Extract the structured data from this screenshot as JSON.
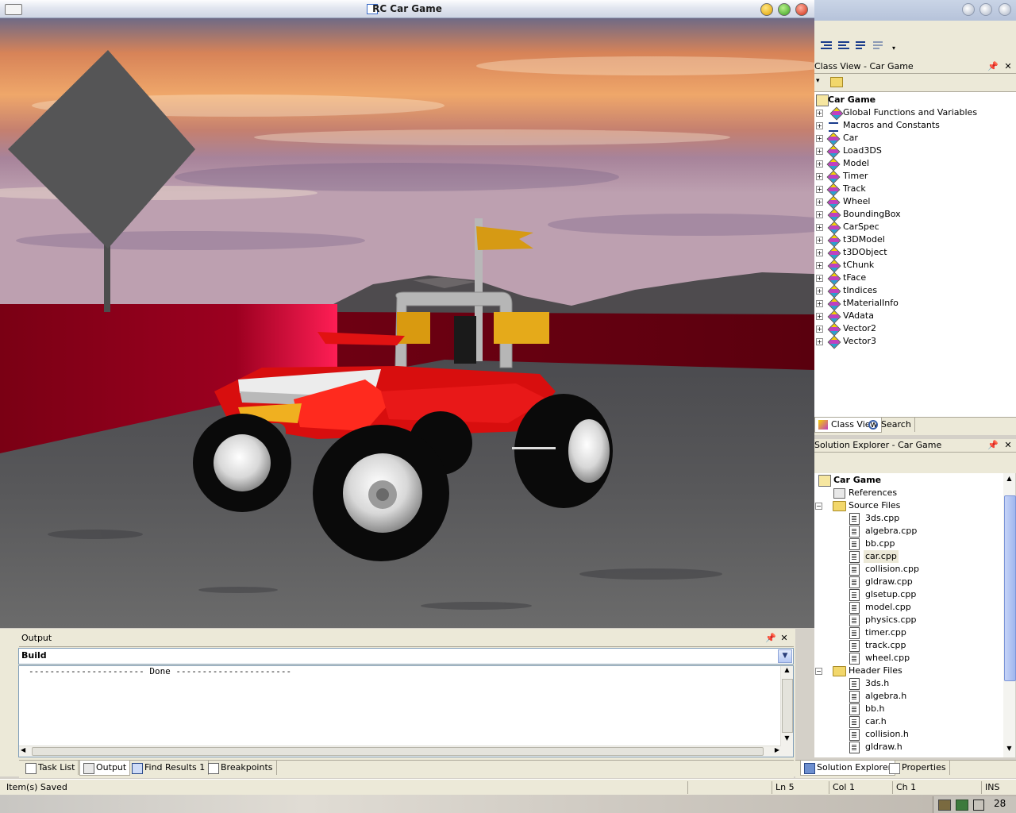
{
  "game_window": {
    "title": "RC Car Game"
  },
  "class_view": {
    "title": "Class View - Car Game",
    "root": "Car Game",
    "items": [
      "Global Functions and Variables",
      "Macros and Constants",
      "Car",
      "Load3DS",
      "Model",
      "Timer",
      "Track",
      "Wheel",
      "BoundingBox",
      "CarSpec",
      "t3DModel",
      "t3DObject",
      "tChunk",
      "tFace",
      "tIndices",
      "tMaterialInfo",
      "VAdata",
      "Vector2",
      "Vector3"
    ],
    "tabs": [
      "Class View",
      "Search"
    ]
  },
  "solution_explorer": {
    "title": "Solution Explorer - Car Game",
    "root": "Car Game",
    "references": "References",
    "source_folder": "Source Files",
    "source_files": [
      "3ds.cpp",
      "algebra.cpp",
      "bb.cpp",
      "car.cpp",
      "collision.cpp",
      "gldraw.cpp",
      "glsetup.cpp",
      "model.cpp",
      "physics.cpp",
      "timer.cpp",
      "track.cpp",
      "wheel.cpp"
    ],
    "header_folder": "Header Files",
    "header_files": [
      "3ds.h",
      "algebra.h",
      "bb.h",
      "car.h",
      "collision.h",
      "gldraw.h"
    ],
    "selected_file": "car.cpp",
    "tabs": [
      "Solution Explorer",
      "Properties"
    ]
  },
  "output": {
    "title": "Output",
    "source": "Build",
    "text": "---------------------- Done ----------------------",
    "tabs": [
      "Task List",
      "Output",
      "Find Results 1",
      "Breakpoints"
    ],
    "active_tab": "Output"
  },
  "status": {
    "message": "Item(s) Saved",
    "ln": "Ln 5",
    "col": "Col 1",
    "ch": "Ch 1",
    "mode": "INS"
  },
  "tray": {
    "clock": "28"
  },
  "colors": {
    "selection": "#316ac5",
    "wall": "#6e0010",
    "car_body": "#e01010",
    "accent": "#e8b020"
  }
}
